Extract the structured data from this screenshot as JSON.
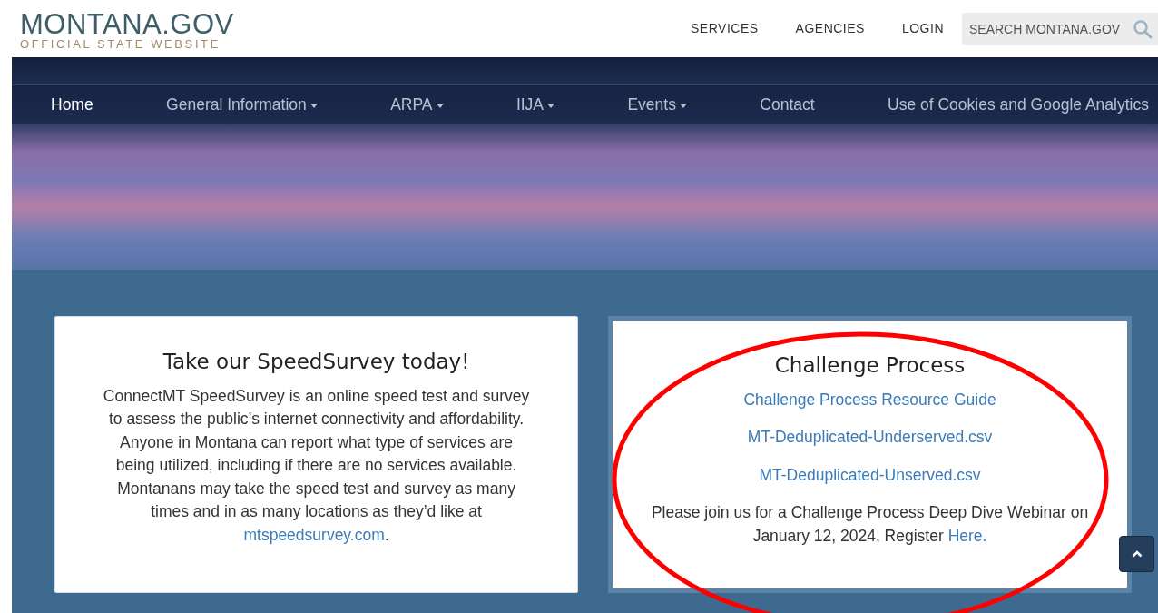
{
  "header": {
    "logo_title": "MONTANA.GOV",
    "logo_subtitle": "OFFICIAL STATE WEBSITE",
    "links": [
      "SERVICES",
      "AGENCIES",
      "LOGIN"
    ],
    "search": {
      "placeholder": "SEARCH MONTANA.GOV"
    }
  },
  "nav": [
    {
      "label": "Home",
      "selected": true,
      "dropdown": false
    },
    {
      "label": "General Information",
      "selected": false,
      "dropdown": true
    },
    {
      "label": "ARPA",
      "selected": false,
      "dropdown": true
    },
    {
      "label": "IIJA",
      "selected": false,
      "dropdown": true
    },
    {
      "label": "Events",
      "selected": false,
      "dropdown": true
    },
    {
      "label": "Contact",
      "selected": false,
      "dropdown": false
    },
    {
      "label": "Use of Cookies and Google Analytics",
      "selected": false,
      "dropdown": false
    }
  ],
  "survey_card": {
    "title": "Take our SpeedSurvey today!",
    "text": "ConnectMT SpeedSurvey is an online speed test and survey to assess the public’s internet connectivity and affordability. Anyone in Montana can report what type of services are being utilized, including if there are no services available.  Montanans may take the speed test and survey as many times and in as many locations as they’d like at ",
    "link": "mtspeedsurvey.com",
    "after": "."
  },
  "challenge_card": {
    "title": "Challenge Process",
    "links": [
      "Challenge Process Resource Guide",
      "MT-Deduplicated-Underserved.csv",
      "MT-Deduplicated-Unserved.csv"
    ],
    "text": "Please join us for a Challenge Process Deep Dive Webinar on January 12, 2024, Register ",
    "link": "Here."
  },
  "annotation": {
    "kind": "circle",
    "color": "#ff0000"
  }
}
